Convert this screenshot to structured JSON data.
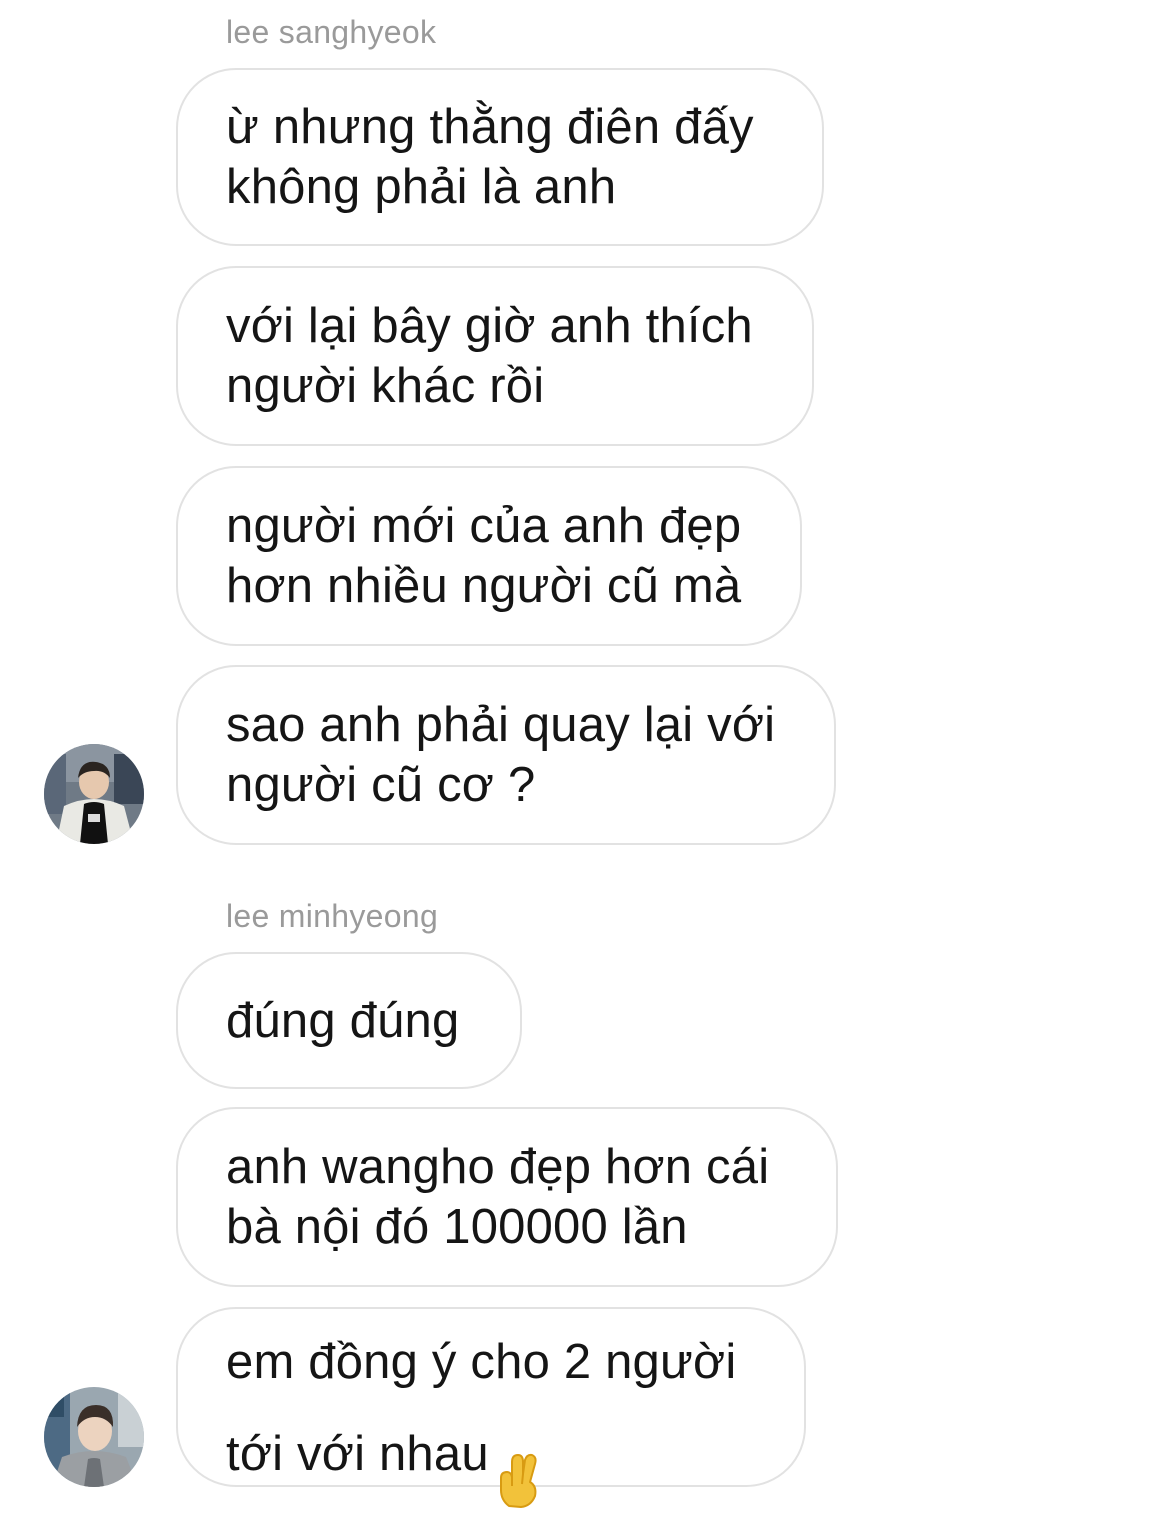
{
  "threads": [
    {
      "sender": "lee sanghyeok",
      "messages": [
        "ừ nhưng thằng điên đấy\nkhông phải là anh",
        "với lại bây giờ anh thích\nngười khác rồi",
        "người mới của anh đẹp\nhơn nhiều người cũ mà",
        "sao anh phải quay lại với\nngười cũ cơ ?"
      ],
      "avatar": "avatar-sanghyeok"
    },
    {
      "sender": "lee minhyeong",
      "messages": [
        "đúng đúng",
        "anh wangho đẹp hơn cái\nbà nội đó 100000 lần",
        "em đồng ý cho 2 người\ntới với nhau"
      ],
      "avatar": "avatar-minhyeong",
      "last_emoji": "crossed-fingers-emoji"
    }
  ],
  "colors": {
    "bubble_border": "#e2e2e2",
    "sender_text": "#9a9a9a",
    "message_text": "#151515",
    "emoji": "#f2c23a"
  }
}
